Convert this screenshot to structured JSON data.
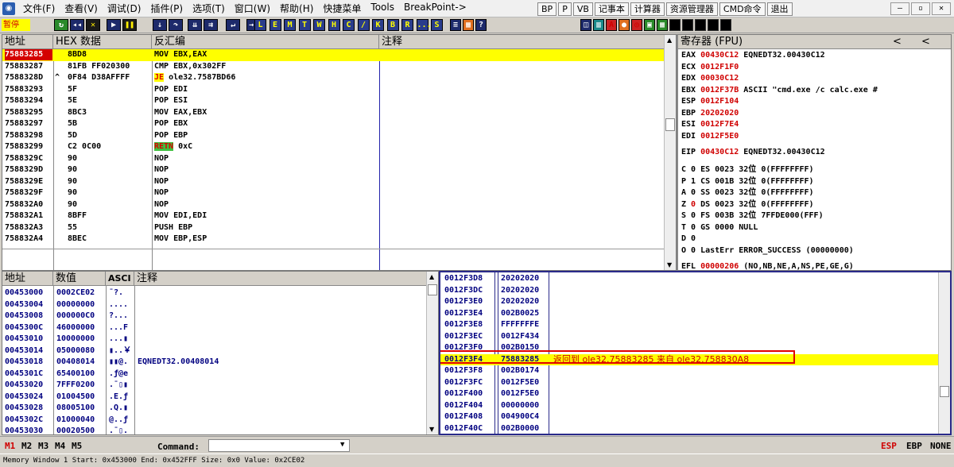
{
  "menu": {
    "items": [
      "文件(F)",
      "查看(V)",
      "调试(D)",
      "插件(P)",
      "选项(T)",
      "窗口(W)",
      "帮助(H)",
      "快捷菜单",
      "Tools",
      "BreakPoint->"
    ],
    "buttons": [
      "BP",
      "P",
      "VB",
      "记事本",
      "计算器",
      "资源管理器",
      "CMD命令",
      "退出"
    ],
    "winctl": [
      "–",
      "▫",
      "✕"
    ]
  },
  "toolbar": {
    "status": "暂停",
    "letters": [
      "L",
      "E",
      "M",
      "T",
      "W",
      "H",
      "C",
      "/",
      "K",
      "B",
      "R",
      "...",
      "S"
    ],
    "icons": [
      "play-icon",
      "pause-icon",
      "stop-icon",
      "step-into-icon",
      "step-over-icon",
      "trace-icon",
      "animate-icon",
      "execute-till-return-icon"
    ]
  },
  "disasm": {
    "headers": {
      "addr": "地址",
      "hex": "HEX 数据",
      "asm": "反汇编",
      "comment": "注释"
    },
    "rows": [
      {
        "addr": "75883285",
        "hex": "8BD8",
        "asm": "MOV EBX,EAX",
        "mark": ""
      },
      {
        "addr": "75883287",
        "hex": "81FB FF020300",
        "asm": "CMP EBX,0x302FF",
        "mark": ""
      },
      {
        "addr": "7588328D",
        "hex": "0F84 D38AFFFF",
        "asm": "ole32.7587BD66",
        "op": "JE",
        "mark": "^"
      },
      {
        "addr": "75883293",
        "hex": "5F",
        "asm": "POP EDI",
        "mark": ""
      },
      {
        "addr": "75883294",
        "hex": "5E",
        "asm": "POP ESI",
        "mark": ""
      },
      {
        "addr": "75883295",
        "hex": "8BC3",
        "asm": "MOV EAX,EBX",
        "mark": ""
      },
      {
        "addr": "75883297",
        "hex": "5B",
        "asm": "POP EBX",
        "mark": ""
      },
      {
        "addr": "75883298",
        "hex": "5D",
        "asm": "POP EBP",
        "mark": ""
      },
      {
        "addr": "75883299",
        "hex": "C2 0C00",
        "asm": "0xC",
        "op": "RETN",
        "mark": ""
      },
      {
        "addr": "7588329C",
        "hex": "90",
        "asm": "NOP",
        "mark": ""
      },
      {
        "addr": "7588329D",
        "hex": "90",
        "asm": "NOP",
        "mark": ""
      },
      {
        "addr": "7588329E",
        "hex": "90",
        "asm": "NOP",
        "mark": ""
      },
      {
        "addr": "7588329F",
        "hex": "90",
        "asm": "NOP",
        "mark": ""
      },
      {
        "addr": "758832A0",
        "hex": "90",
        "asm": "NOP",
        "mark": ""
      },
      {
        "addr": "758832A1",
        "hex": "8BFF",
        "asm": "MOV EDI,EDI",
        "mark": ""
      },
      {
        "addr": "758832A3",
        "hex": "55",
        "asm": "PUSH EBP",
        "mark": ""
      },
      {
        "addr": "758832A4",
        "hex": "8BEC",
        "asm": "MOV EBP,ESP",
        "mark": ""
      }
    ]
  },
  "registers": {
    "title": "寄存器 (FPU)",
    "nav": [
      "<",
      "<"
    ],
    "gp": [
      {
        "name": "EAX",
        "value": "00430C12",
        "info": "EQNEDT32.00430C12"
      },
      {
        "name": "ECX",
        "value": "0012F1F0",
        "info": ""
      },
      {
        "name": "EDX",
        "value": "00030C12",
        "info": ""
      },
      {
        "name": "EBX",
        "value": "0012F37B",
        "info": "ASCII \"cmd.exe /c calc.exe #"
      },
      {
        "name": "ESP",
        "value": "0012F104",
        "info": ""
      },
      {
        "name": "EBP",
        "value": "20202020",
        "info": ""
      },
      {
        "name": "ESI",
        "value": "0012F7E4",
        "info": ""
      },
      {
        "name": "EDI",
        "value": "0012F5E0",
        "info": ""
      }
    ],
    "eip": {
      "name": "EIP",
      "value": "00430C12",
      "info": "EQNEDT32.00430C12"
    },
    "flags": [
      {
        "f": "C",
        "v": "0",
        "seg": "ES",
        "sel": "0023",
        "bits": "32位",
        "base": "0(FFFFFFFF)"
      },
      {
        "f": "P",
        "v": "1",
        "seg": "CS",
        "sel": "001B",
        "bits": "32位",
        "base": "0(FFFFFFFF)"
      },
      {
        "f": "A",
        "v": "0",
        "seg": "SS",
        "sel": "0023",
        "bits": "32位",
        "base": "0(FFFFFFFF)"
      },
      {
        "f": "Z",
        "v": "0",
        "seg": "DS",
        "sel": "0023",
        "bits": "32位",
        "base": "0(FFFFFFFF)"
      },
      {
        "f": "S",
        "v": "0",
        "seg": "FS",
        "sel": "003B",
        "bits": "32位",
        "base": "7FFDE000(FFF)"
      },
      {
        "f": "T",
        "v": "0",
        "seg": "GS",
        "sel": "0000",
        "bits": "",
        "base": "NULL"
      },
      {
        "f": "D",
        "v": "0",
        "seg": "",
        "sel": "",
        "bits": "",
        "base": ""
      },
      {
        "f": "O",
        "v": "0",
        "seg": "",
        "sel": "",
        "bits": "",
        "base": "LastErr ERROR_SUCCESS (00000000)"
      }
    ],
    "efl": {
      "name": "EFL",
      "value": "00000206",
      "info": "(NO,NB,NE,A,NS,PE,GE,G)"
    }
  },
  "dump": {
    "headers": {
      "addr": "地址",
      "val": "数值",
      "ascii": "ASCI",
      "comment": "注释"
    },
    "rows": [
      {
        "addr": "00453000",
        "val": "0002CE02",
        "ascii": "ˉ?.",
        "comment": ""
      },
      {
        "addr": "00453004",
        "val": "00000000",
        "ascii": "....",
        "comment": ""
      },
      {
        "addr": "00453008",
        "val": "000000C0",
        "ascii": "?...",
        "comment": ""
      },
      {
        "addr": "0045300C",
        "val": "46000000",
        "ascii": "...F",
        "comment": ""
      },
      {
        "addr": "00453010",
        "val": "10000000",
        "ascii": "...▮",
        "comment": ""
      },
      {
        "addr": "00453014",
        "val": "05000080",
        "ascii": "▮..￥",
        "comment": ""
      },
      {
        "addr": "00453018",
        "val": "00408014",
        "ascii": "▮▮@.",
        "comment": "EQNEDT32.00408014"
      },
      {
        "addr": "0045301C",
        "val": "65400100",
        "ascii": ".ƒ@e",
        "comment": ""
      },
      {
        "addr": "00453020",
        "val": "7FFF0200",
        "ascii": ".ˉ▯▮",
        "comment": ""
      },
      {
        "addr": "00453024",
        "val": "01004500",
        "ascii": ".E.ƒ",
        "comment": ""
      },
      {
        "addr": "00453028",
        "val": "08005100",
        "ascii": ".Q.▮",
        "comment": ""
      },
      {
        "addr": "0045302C",
        "val": "01000040",
        "ascii": "@..ƒ",
        "comment": ""
      },
      {
        "addr": "00453030",
        "val": "00020500",
        "ascii": ".ˉ▯.",
        "comment": ""
      }
    ]
  },
  "stack": {
    "rows": [
      {
        "addr": "0012F3D8",
        "val": "20202020",
        "comment": ""
      },
      {
        "addr": "0012F3DC",
        "val": "20202020",
        "comment": ""
      },
      {
        "addr": "0012F3E0",
        "val": "20202020",
        "comment": ""
      },
      {
        "addr": "0012F3E4",
        "val": "002B0025",
        "comment": ""
      },
      {
        "addr": "0012F3E8",
        "val": "FFFFFFFE",
        "comment": ""
      },
      {
        "addr": "0012F3EC",
        "val": "0012F434",
        "comment": ""
      },
      {
        "addr": "0012F3F0",
        "val": "002B0150",
        "comment": ""
      },
      {
        "addr": "0012F3F4",
        "val": "75883285",
        "comment": "返回到 ole32.75883285 来自 ole32.758830A8"
      },
      {
        "addr": "0012F3F8",
        "val": "002B0174",
        "comment": ""
      },
      {
        "addr": "0012F3FC",
        "val": "0012F5E0",
        "comment": ""
      },
      {
        "addr": "0012F400",
        "val": "0012F5E0",
        "comment": ""
      },
      {
        "addr": "0012F404",
        "val": "00000000",
        "comment": ""
      },
      {
        "addr": "0012F408",
        "val": "004900C4",
        "comment": ""
      },
      {
        "addr": "0012F40C",
        "val": "002B0000",
        "comment": ""
      }
    ]
  },
  "bottom": {
    "tabs": [
      "M1",
      "M2",
      "M3",
      "M4",
      "M5"
    ],
    "command_label": "Command:",
    "right": [
      "ESP",
      "EBP",
      "NONE"
    ]
  },
  "statusline": "Memory Window 1  Start: 0x453000  End: 0x452FFF  Size: 0x0 Value: 0x2CE02",
  "colors": {
    "highlight": "#ffff00",
    "accent_red": "#d00000",
    "selection": "#d40000"
  }
}
